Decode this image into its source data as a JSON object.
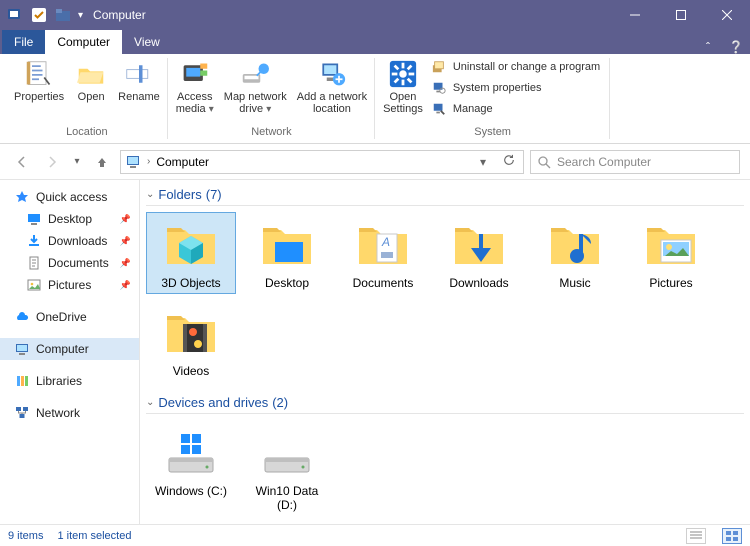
{
  "window": {
    "title": "Computer"
  },
  "tabs": {
    "file": "File",
    "computer": "Computer",
    "view": "View"
  },
  "ribbon": {
    "location": {
      "label": "Location",
      "properties": "Properties",
      "open": "Open",
      "rename": "Rename"
    },
    "network": {
      "label": "Network",
      "access_media": "Access\nmedia",
      "map_drive": "Map network\ndrive",
      "add_location": "Add a network\nlocation"
    },
    "system": {
      "label": "System",
      "open_settings": "Open\nSettings",
      "uninstall": "Uninstall or change a program",
      "sys_props": "System properties",
      "manage": "Manage"
    }
  },
  "address": {
    "crumb1": "Computer"
  },
  "search": {
    "placeholder": "Search Computer"
  },
  "tree": {
    "quick_access": "Quick access",
    "desktop": "Desktop",
    "downloads": "Downloads",
    "documents": "Documents",
    "pictures": "Pictures",
    "onedrive": "OneDrive",
    "computer": "Computer",
    "libraries": "Libraries",
    "network": "Network"
  },
  "groups": {
    "folders": {
      "label": "Folders",
      "count": "(7)"
    },
    "devices": {
      "label": "Devices and drives",
      "count": "(2)"
    }
  },
  "folders": {
    "3d": "3D Objects",
    "desktop": "Desktop",
    "documents": "Documents",
    "downloads": "Downloads",
    "music": "Music",
    "pictures": "Pictures",
    "videos": "Videos"
  },
  "drives": {
    "c": "Windows (C:)",
    "d": "Win10 Data (D:)"
  },
  "status": {
    "items": "9 items",
    "selected": "1 item selected"
  }
}
